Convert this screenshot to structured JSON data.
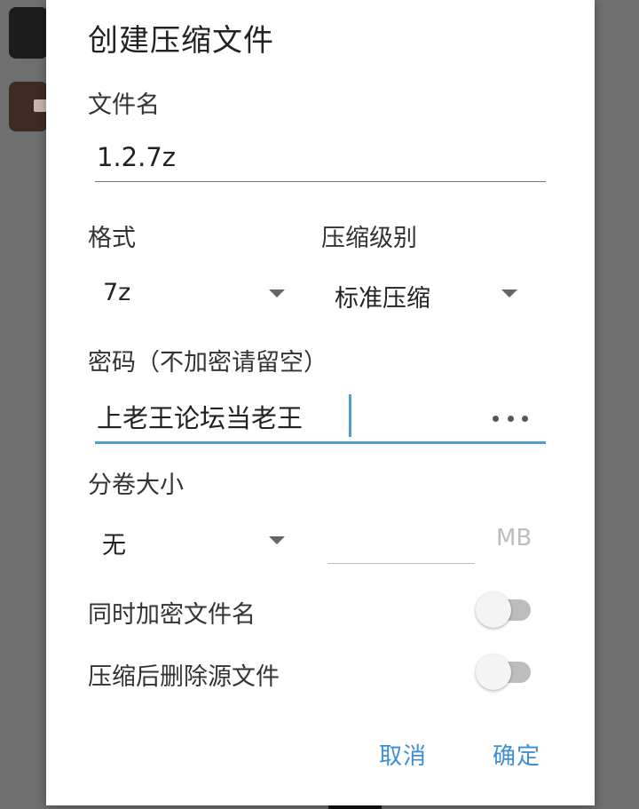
{
  "dialog": {
    "title": "创建压缩文件",
    "filename": {
      "label": "文件名",
      "value": "1.2.7z"
    },
    "format": {
      "label": "格式",
      "selected": "7z"
    },
    "level": {
      "label": "压缩级别",
      "selected": "标准压缩"
    },
    "password": {
      "label": "密码（不加密请留空）",
      "value": "上老王论坛当老王",
      "toggle_icon": "more-dots-icon"
    },
    "split": {
      "label": "分卷大小",
      "selected": "无",
      "size_value": "",
      "unit": "MB"
    },
    "encrypt_names": {
      "label": "同时加密文件名",
      "checked": false
    },
    "delete_source": {
      "label": "压缩后删除源文件",
      "checked": false
    },
    "buttons": {
      "cancel": "取消",
      "confirm": "确定"
    }
  },
  "colors": {
    "accent": "#3d8fd1",
    "active_underline": "#4f9fd6",
    "toggle_off_track": "#bdbdbd"
  }
}
